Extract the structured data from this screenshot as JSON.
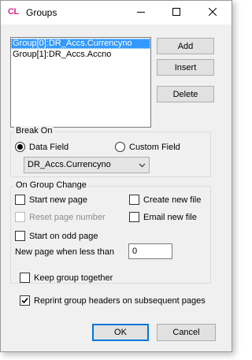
{
  "window": {
    "title": "Groups",
    "app_icon_text": "CL"
  },
  "titlebar": {
    "minimize_glyph": "─",
    "maximize_glyph": "☐",
    "close_glyph": "✕"
  },
  "groups_list": {
    "items": [
      {
        "label": "Group[0]:DR_Accs.Currencyno",
        "selected": true
      },
      {
        "label": "Group[1]:DR_Accs.Accno",
        "selected": false
      }
    ]
  },
  "side_buttons": {
    "add": "Add",
    "insert": "Insert",
    "delete": "Delete"
  },
  "break_on": {
    "title": "Break On",
    "data_field_label": "Data Field",
    "custom_field_label": "Custom Field",
    "selected": "data_field",
    "field_value": "DR_Accs.Currencyno"
  },
  "on_group_change": {
    "title": "On Group Change",
    "start_new_page": "Start new page",
    "create_new_file": "Create new file",
    "reset_page_number": "Reset page number",
    "email_new_file": "Email new file",
    "start_on_odd_page": "Start on odd page",
    "new_page_when_less_than_label": "New page when less than",
    "new_page_when_less_than_value": "0"
  },
  "options": {
    "keep_group_together": "Keep group together",
    "keep_group_together_checked": false,
    "reprint_headers": "Reprint group headers on subsequent pages",
    "reprint_headers_checked": true
  },
  "footer": {
    "ok": "OK",
    "cancel": "Cancel"
  }
}
